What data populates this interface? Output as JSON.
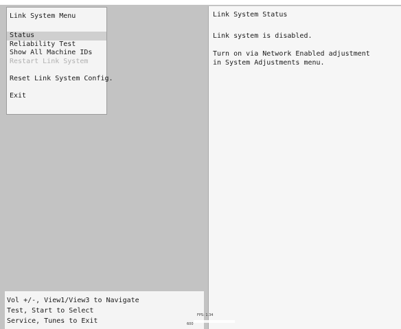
{
  "menu": {
    "title": "Link System Menu",
    "items": [
      {
        "label": "Status",
        "state": "selected"
      },
      {
        "label": "Reliability Test",
        "state": "enabled"
      },
      {
        "label": "Show All Machine IDs",
        "state": "enabled"
      },
      {
        "label": "Restart Link System",
        "state": "disabled"
      },
      {
        "label": "Reset Link System Config.",
        "state": "enabled"
      },
      {
        "label": "Exit",
        "state": "enabled"
      }
    ]
  },
  "status": {
    "title": "Link System Status",
    "lines": [
      "Link system is disabled.",
      "",
      "Turn on via Network Enabled adjustment",
      "in System Adjustments menu."
    ]
  },
  "help": {
    "lines": [
      "Vol +/-, View1/View3 to Navigate",
      "Test, Start to Select",
      "Service, Tunes to Exit"
    ]
  },
  "overlay": {
    "fps_text": "FPS: 1.34",
    "counter_text": "600"
  },
  "colors": {
    "background": "#c3c3c3",
    "panel": "#f4f4f4",
    "selected_row": "#cfcfcf",
    "disabled_text": "#b0b0b0"
  }
}
